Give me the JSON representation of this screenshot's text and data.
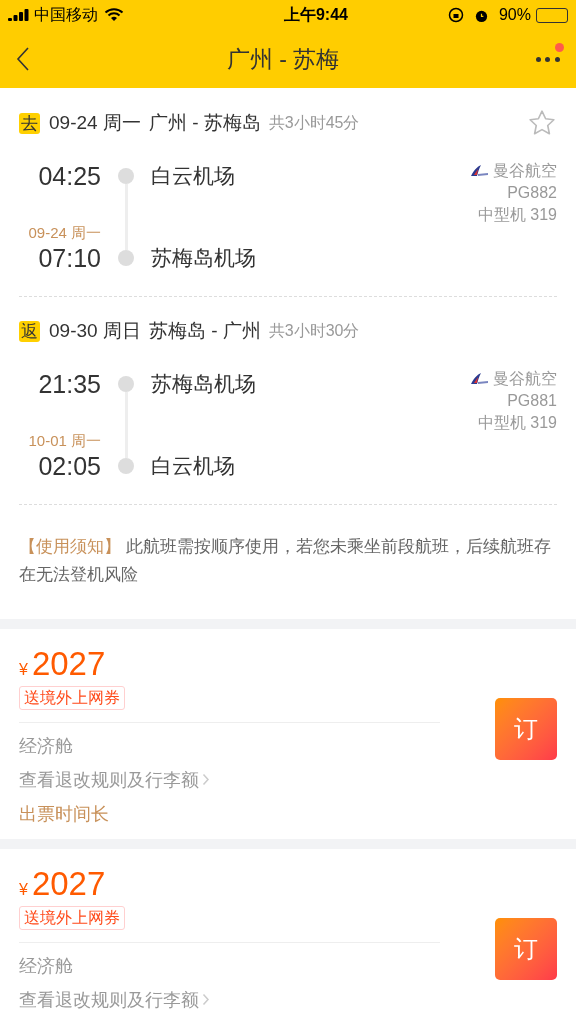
{
  "status_bar": {
    "carrier": "中国移动",
    "time": "上午9:44",
    "battery": "90%"
  },
  "nav": {
    "title": "广州 - 苏梅",
    "has_notification": true
  },
  "itinerary": {
    "favorited": false,
    "legs": [
      {
        "badge": "去",
        "date": "09-24 周一",
        "route": "广州 - 苏梅岛",
        "duration": "共3小时45分",
        "departure": {
          "time": "04:25",
          "airport": "白云机场"
        },
        "arrival": {
          "date_note": "09-24 周一",
          "time": "07:10",
          "airport": "苏梅岛机场"
        },
        "airline": "曼谷航空",
        "flight_no": "PG882",
        "aircraft": "中型机 319"
      },
      {
        "badge": "返",
        "date": "09-30 周日",
        "route": "苏梅岛 - 广州",
        "duration": "共3小时30分",
        "departure": {
          "time": "21:35",
          "airport": "苏梅岛机场"
        },
        "arrival": {
          "date_note": "10-01 周一",
          "time": "02:05",
          "airport": "白云机场"
        },
        "airline": "曼谷航空",
        "flight_no": "PG881",
        "aircraft": "中型机 319"
      }
    ],
    "notice": {
      "label": "【使用须知】",
      "text": "此航班需按顺序使用，若您未乘坐前段航班，后续航班存在无法登机风险"
    }
  },
  "offers": [
    {
      "currency": "¥",
      "price": "2027",
      "tag": "送境外上网券",
      "cabin": "经济舱",
      "rules_link": "查看退改规则及行李额",
      "note": "出票时间长",
      "button": "订"
    },
    {
      "currency": "¥",
      "price": "2027",
      "tag": "送境外上网券",
      "cabin": "经济舱",
      "rules_link": "查看退改规则及行李额",
      "button": "订"
    }
  ]
}
